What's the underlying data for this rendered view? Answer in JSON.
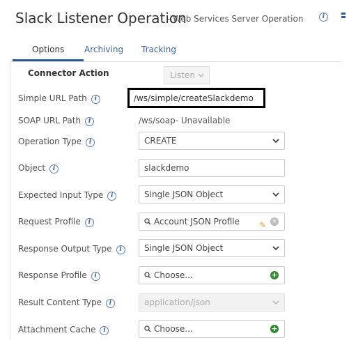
{
  "header": {
    "title": "Slack Listener Operation",
    "subtitle": "- Web Services Server Operation"
  },
  "tabs": [
    {
      "label": "Options",
      "active": true
    },
    {
      "label": "Archiving",
      "active": false
    },
    {
      "label": "Tracking",
      "active": false
    }
  ],
  "form": {
    "connector_action": {
      "label": "Connector Action",
      "value": "Listen"
    },
    "simple_url_path": {
      "label": "Simple URL Path",
      "value": "/ws/simple/createSlackdemo"
    },
    "soap_url_path": {
      "label": "SOAP URL Path",
      "value": "/ws/soap- Unavailable"
    },
    "operation_type": {
      "label": "Operation Type",
      "value": "CREATE"
    },
    "object": {
      "label": "Object",
      "value": "slackdemo"
    },
    "expected_input_type": {
      "label": "Expected Input Type",
      "value": "Single JSON Object"
    },
    "request_profile": {
      "label": "Request Profile",
      "value": "Account JSON Profile"
    },
    "response_output_type": {
      "label": "Response Output Type",
      "value": "Single JSON Object"
    },
    "response_profile": {
      "label": "Response Profile",
      "placeholder": "Choose..."
    },
    "result_content_type": {
      "label": "Result Content Type",
      "value": "application/json"
    },
    "attachment_cache": {
      "label": "Attachment Cache",
      "placeholder": "Choose..."
    }
  },
  "icons": {
    "info": "i",
    "plus": "+",
    "clear": "×",
    "pencil": "✎"
  },
  "colors": {
    "link": "#3b66a8",
    "tab_underline": "#2e5b96",
    "add_green": "#2f8a2f"
  }
}
